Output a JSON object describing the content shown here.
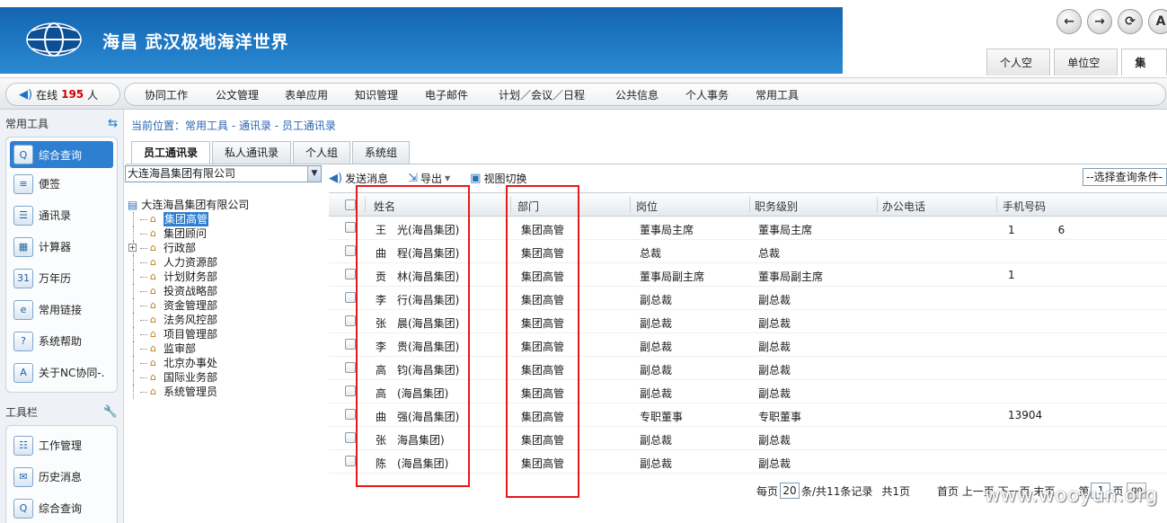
{
  "header": {
    "title": "海昌 武汉极地海洋世界",
    "nav_buttons": [
      "←",
      "→",
      "⟳",
      "A"
    ],
    "space_tabs": [
      "个人空间",
      "单位空间",
      "集团"
    ]
  },
  "navbar": {
    "online_prefix": "在线",
    "online_count": "195",
    "online_suffix": "人",
    "menu": [
      "协同工作",
      "公文管理",
      "表单应用",
      "知识管理",
      "电子邮件",
      "计划／会议／日程",
      "公共信息",
      "个人事务",
      "常用工具"
    ]
  },
  "sidebar": {
    "tools_title": "常用工具",
    "items": [
      {
        "label": "综合查询",
        "icon": "query-icon",
        "glyph": "Q"
      },
      {
        "label": "便签",
        "icon": "note-icon",
        "glyph": "≡"
      },
      {
        "label": "通讯录",
        "icon": "addressbook-icon",
        "glyph": "☰"
      },
      {
        "label": "计算器",
        "icon": "calculator-icon",
        "glyph": "▦"
      },
      {
        "label": "万年历",
        "icon": "calendar-icon",
        "glyph": "31"
      },
      {
        "label": "常用链接",
        "icon": "link-icon",
        "glyph": "e"
      },
      {
        "label": "系统帮助",
        "icon": "help-icon",
        "glyph": "?"
      },
      {
        "label": "关于NC协同-.",
        "icon": "about-icon",
        "glyph": "A"
      }
    ],
    "toolbar_title": "工具栏",
    "toolbar_items": [
      {
        "label": "工作管理",
        "icon": "work-icon",
        "glyph": "☷"
      },
      {
        "label": "历史消息",
        "icon": "history-icon",
        "glyph": "✉"
      },
      {
        "label": "综合查询",
        "icon": "query-icon",
        "glyph": "Q"
      }
    ]
  },
  "breadcrumb": "当前位置：常用工具 - 通讯录 - 员工通讯录",
  "tabs": [
    "员工通讯录",
    "私人通讯录",
    "个人组",
    "系统组"
  ],
  "org_select": "大连海昌集团有限公司",
  "tree": {
    "root": "大连海昌集团有限公司",
    "nodes": [
      "集团高管",
      "集团顾问",
      "行政部",
      "人力资源部",
      "计划财务部",
      "投资战略部",
      "资金管理部",
      "法务风控部",
      "项目管理部",
      "监审部",
      "北京办事处",
      "国际业务部",
      "系统管理员"
    ]
  },
  "toolbar": {
    "send": "发送消息",
    "export": "导出",
    "switch_view": "视图切换",
    "query_condition": "--选择查询条件--"
  },
  "table": {
    "headers": [
      "姓名",
      "部门",
      "岗位",
      "职务级别",
      "办公电话",
      "手机号码"
    ],
    "rows": [
      {
        "name": "王　光(海昌集团)",
        "dept": "集团高管",
        "post": "董事局主席",
        "level": "董事局主席",
        "mobile": "1　　　　6"
      },
      {
        "name": "曲　程(海昌集团)",
        "dept": "集团高管",
        "post": "总裁",
        "level": "总裁",
        "mobile": ""
      },
      {
        "name": "贡　林(海昌集团)",
        "dept": "集团高管",
        "post": "董事局副主席",
        "level": "董事局副主席",
        "mobile": "1"
      },
      {
        "name": "李　行(海昌集团)",
        "dept": "集团高管",
        "post": "副总裁",
        "level": "副总裁",
        "mobile": ""
      },
      {
        "name": "张　晨(海昌集团)",
        "dept": "集团高管",
        "post": "副总裁",
        "level": "副总裁",
        "mobile": ""
      },
      {
        "name": "李　贵(海昌集团)",
        "dept": "集团高管",
        "post": "副总裁",
        "level": "副总裁",
        "mobile": ""
      },
      {
        "name": "高　钧(海昌集团)",
        "dept": "集团高管",
        "post": "副总裁",
        "level": "副总裁",
        "mobile": ""
      },
      {
        "name": "高　(海昌集团)",
        "dept": "集团高管",
        "post": "副总裁",
        "level": "副总裁",
        "mobile": ""
      },
      {
        "name": "曲　强(海昌集团)",
        "dept": "集团高管",
        "post": "专职董事",
        "level": "专职董事",
        "mobile": "13904"
      },
      {
        "name": "张　海昌集团)",
        "dept": "集团高管",
        "post": "副总裁",
        "level": "副总裁",
        "mobile": ""
      },
      {
        "name": "陈　(海昌集团)",
        "dept": "集团高管",
        "post": "副总裁",
        "level": "副总裁",
        "mobile": ""
      }
    ]
  },
  "pager": {
    "per_page_prefix": "每页",
    "per_page": "20",
    "per_page_suffix": "条/共11条记录",
    "total_pages": "共1页",
    "nav": "首页 上一页 下一页 末页",
    "page_prefix": "第",
    "page": "1",
    "page_suffix": "页",
    "go": "go"
  },
  "watermark": "www.wooyun.org",
  "colors": {
    "banner": "#1e79c4",
    "accent": "#2f7fd0",
    "highlight_box": "#e31b1b",
    "count": "#d40000"
  }
}
